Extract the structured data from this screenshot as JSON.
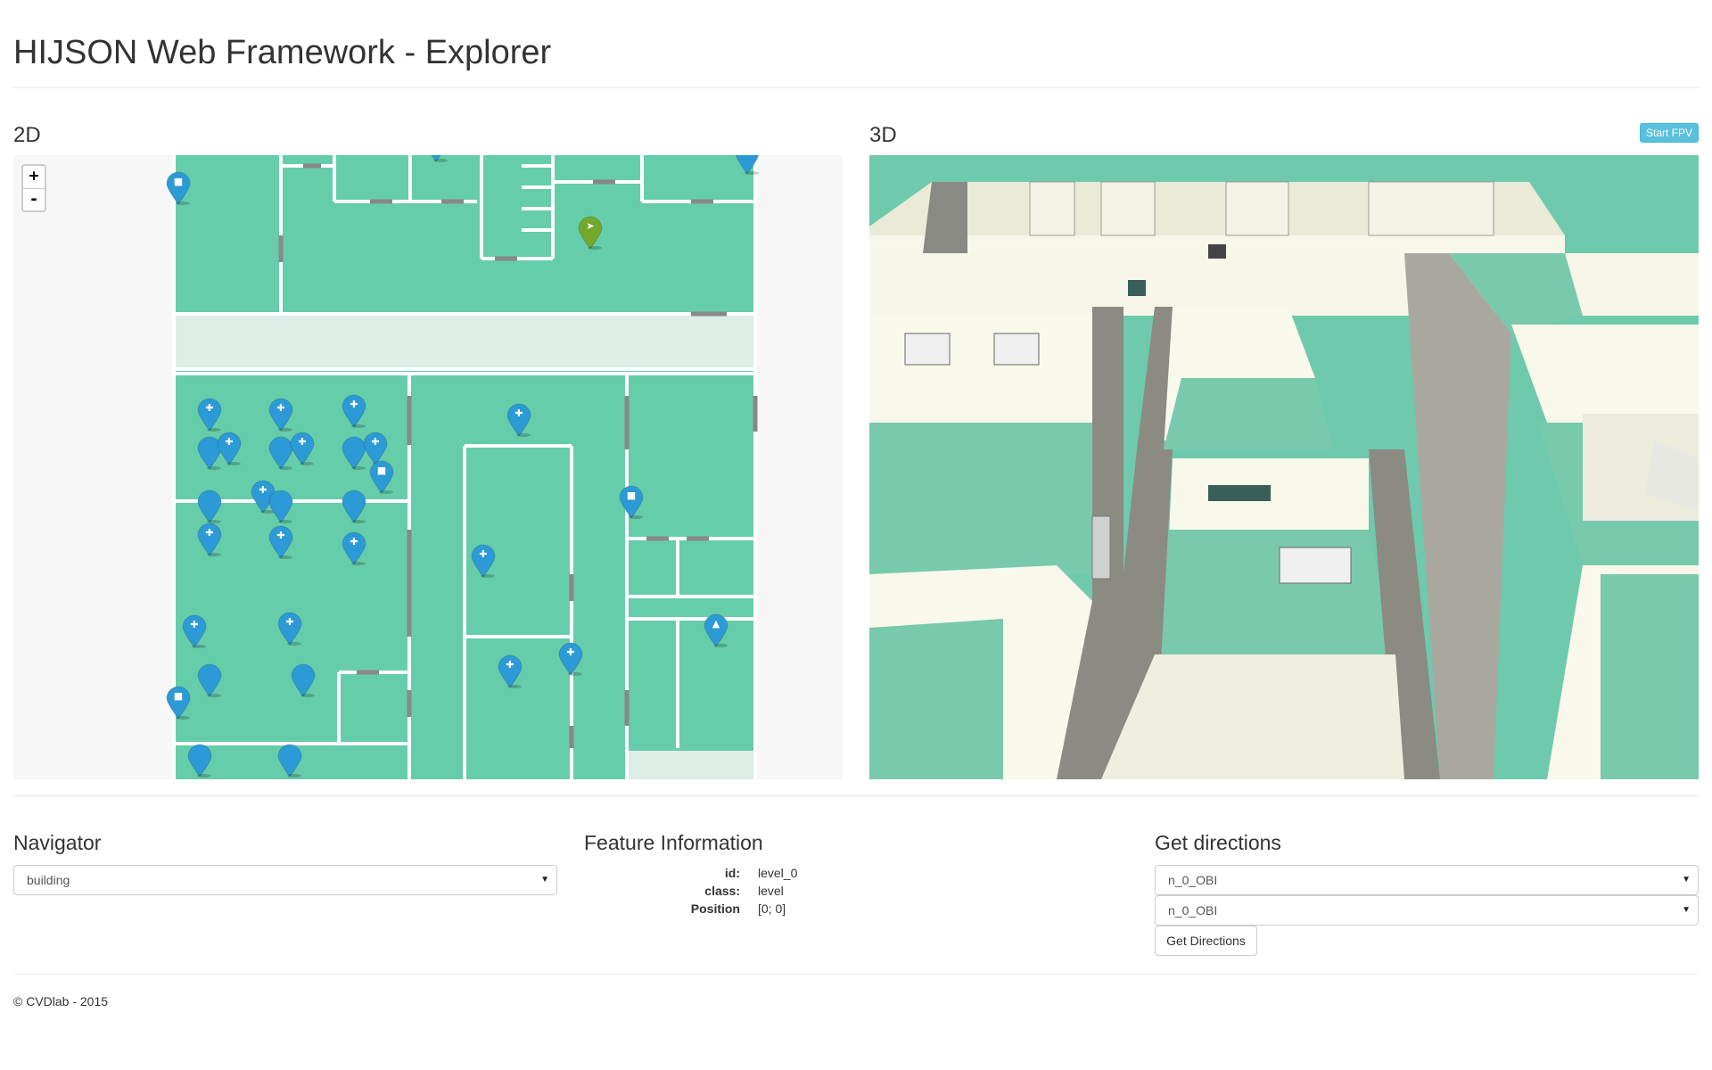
{
  "header": {
    "title": "HIJSON Web Framework - Explorer"
  },
  "view2d": {
    "title": "2D",
    "zoom_in": "+",
    "zoom_out": "-"
  },
  "view3d": {
    "title": "3D",
    "fpv_button": "Start FPV"
  },
  "navigator": {
    "title": "Navigator",
    "selected": "building"
  },
  "feature_info": {
    "title": "Feature Information",
    "rows": [
      {
        "key": "id:",
        "value": "level_0"
      },
      {
        "key": "class:",
        "value": "level"
      },
      {
        "key": "Position",
        "value": "[0; 0]"
      }
    ]
  },
  "directions": {
    "title": "Get directions",
    "from": "n_0_OBI",
    "to": "n_0_OBI",
    "button": "Get Directions"
  },
  "footer": {
    "text": "© CVDlab - 2015"
  },
  "colors": {
    "floor": "#66cdaa",
    "corridor": "#dceee6",
    "wall": "#ffffff",
    "marker": "#2c9ad6",
    "marker_active": "#73a82c",
    "info_button": "#5bc0de"
  }
}
